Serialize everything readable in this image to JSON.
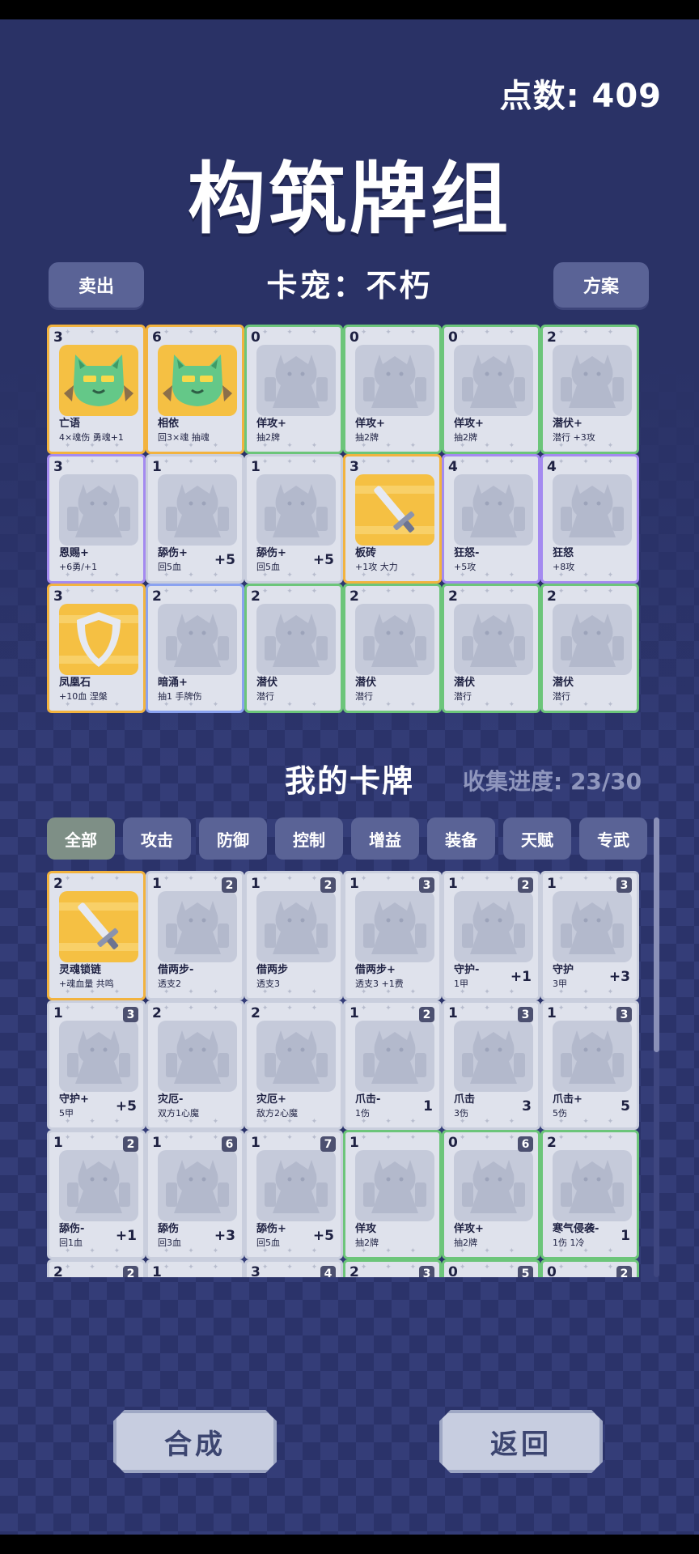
{
  "header": {
    "points_label": "点数: 409",
    "title": "构筑牌组",
    "pet_label": "卡宠：不朽",
    "sell_button": "卖出",
    "plan_button": "方案"
  },
  "deck": [
    {
      "cost": "3",
      "name": "亡语",
      "desc": "4×魂伤 勇魂+1",
      "value": "",
      "border": "orange",
      "art": "cat"
    },
    {
      "cost": "6",
      "name": "相依",
      "desc": "回3×魂 抽魂",
      "value": "",
      "border": "orange",
      "art": "cat"
    },
    {
      "cost": "0",
      "name": "佯攻+",
      "desc": "抽2牌",
      "value": "",
      "border": "green",
      "art": "ghost"
    },
    {
      "cost": "0",
      "name": "佯攻+",
      "desc": "抽2牌",
      "value": "",
      "border": "green",
      "art": "ghost"
    },
    {
      "cost": "0",
      "name": "佯攻+",
      "desc": "抽2牌",
      "value": "",
      "border": "green",
      "art": "ghost"
    },
    {
      "cost": "2",
      "name": "潜伏+",
      "desc": "潜行 +3攻",
      "value": "",
      "border": "green",
      "art": "ghost"
    },
    {
      "cost": "3",
      "name": "恩赐+",
      "desc": "+6勇/+1",
      "value": "",
      "border": "purple",
      "art": "ghost"
    },
    {
      "cost": "1",
      "name": "舔伤+",
      "desc": "回5血",
      "value": "+5",
      "border": "plain",
      "art": "ghost"
    },
    {
      "cost": "1",
      "name": "舔伤+",
      "desc": "回5血",
      "value": "+5",
      "border": "plain",
      "art": "ghost"
    },
    {
      "cost": "3",
      "name": "板砖",
      "desc": "+1攻 大力",
      "value": "",
      "border": "orange",
      "art": "sword"
    },
    {
      "cost": "4",
      "name": "狂怒-",
      "desc": "+5攻",
      "value": "",
      "border": "purple",
      "art": "ghost"
    },
    {
      "cost": "4",
      "name": "狂怒",
      "desc": "+8攻",
      "value": "",
      "border": "purple",
      "art": "ghost"
    },
    {
      "cost": "3",
      "name": "凤凰石",
      "desc": "+10血 涅槃",
      "value": "",
      "border": "orange",
      "art": "shield"
    },
    {
      "cost": "2",
      "name": "暗涌+",
      "desc": "抽1 手牌伤",
      "value": "",
      "border": "blue",
      "art": "ghost"
    },
    {
      "cost": "2",
      "name": "潜伏",
      "desc": "潜行",
      "value": "",
      "border": "green",
      "art": "ghost"
    },
    {
      "cost": "2",
      "name": "潜伏",
      "desc": "潜行",
      "value": "",
      "border": "green",
      "art": "ghost"
    },
    {
      "cost": "2",
      "name": "潜伏",
      "desc": "潜行",
      "value": "",
      "border": "green",
      "art": "ghost"
    },
    {
      "cost": "2",
      "name": "潜伏",
      "desc": "潜行",
      "value": "",
      "border": "green",
      "art": "ghost"
    }
  ],
  "collection": {
    "title": "我的卡牌",
    "progress": "收集进度: 23/30",
    "tabs": [
      "全部",
      "攻击",
      "防御",
      "控制",
      "增益",
      "装备",
      "天赋",
      "专武"
    ],
    "cards": [
      {
        "cost": "2",
        "count": "",
        "name": "灵魂锁链",
        "desc": "+魂血量 共鸣",
        "value": "",
        "border": "orange",
        "art": "sword"
      },
      {
        "cost": "1",
        "count": "2",
        "name": "借两步-",
        "desc": "透支2",
        "value": "",
        "border": "plain",
        "art": "ghost"
      },
      {
        "cost": "1",
        "count": "2",
        "name": "借两步",
        "desc": "透支3",
        "value": "",
        "border": "plain",
        "art": "ghost"
      },
      {
        "cost": "1",
        "count": "3",
        "name": "借两步+",
        "desc": "透支3 +1费",
        "value": "",
        "border": "plain",
        "art": "ghost"
      },
      {
        "cost": "1",
        "count": "2",
        "name": "守护-",
        "desc": "1甲",
        "value": "+1",
        "border": "plain",
        "art": "ghost"
      },
      {
        "cost": "1",
        "count": "3",
        "name": "守护",
        "desc": "3甲",
        "value": "+3",
        "border": "plain",
        "art": "ghost"
      },
      {
        "cost": "1",
        "count": "3",
        "name": "守护+",
        "desc": "5甲",
        "value": "+5",
        "border": "plain",
        "art": "ghost"
      },
      {
        "cost": "2",
        "count": "",
        "name": "灾厄-",
        "desc": "双方1心魔",
        "value": "",
        "border": "plain",
        "art": "ghost"
      },
      {
        "cost": "2",
        "count": "",
        "name": "灾厄+",
        "desc": "敌方2心魔",
        "value": "",
        "border": "plain",
        "art": "ghost"
      },
      {
        "cost": "1",
        "count": "2",
        "name": "爪击-",
        "desc": "1伤",
        "value": "1",
        "border": "plain",
        "art": "ghost"
      },
      {
        "cost": "1",
        "count": "3",
        "name": "爪击",
        "desc": "3伤",
        "value": "3",
        "border": "plain",
        "art": "ghost"
      },
      {
        "cost": "1",
        "count": "3",
        "name": "爪击+",
        "desc": "5伤",
        "value": "5",
        "border": "plain",
        "art": "ghost"
      },
      {
        "cost": "1",
        "count": "2",
        "name": "舔伤-",
        "desc": "回1血",
        "value": "+1",
        "border": "plain",
        "art": "ghost"
      },
      {
        "cost": "1",
        "count": "6",
        "name": "舔伤",
        "desc": "回3血",
        "value": "+3",
        "border": "plain",
        "art": "ghost"
      },
      {
        "cost": "1",
        "count": "7",
        "name": "舔伤+",
        "desc": "回5血",
        "value": "+5",
        "border": "plain",
        "art": "ghost"
      },
      {
        "cost": "1",
        "count": "",
        "name": "佯攻",
        "desc": "抽2牌",
        "value": "",
        "border": "green",
        "art": "ghost"
      },
      {
        "cost": "0",
        "count": "6",
        "name": "佯攻+",
        "desc": "抽2牌",
        "value": "",
        "border": "green",
        "art": "ghost"
      },
      {
        "cost": "2",
        "count": "",
        "name": "寒气侵袭-",
        "desc": "1伤 1冷",
        "value": "1",
        "border": "green",
        "art": "ghost"
      },
      {
        "cost": "2",
        "count": "2",
        "name": "",
        "desc": "",
        "value": "",
        "border": "plain",
        "art": "ghost"
      },
      {
        "cost": "1",
        "count": "",
        "name": "",
        "desc": "",
        "value": "",
        "border": "plain",
        "art": "ghost"
      },
      {
        "cost": "3",
        "count": "4",
        "name": "",
        "desc": "",
        "value": "",
        "border": "plain",
        "art": "ghost"
      },
      {
        "cost": "2",
        "count": "3",
        "name": "",
        "desc": "",
        "value": "",
        "border": "green",
        "art": "ghost"
      },
      {
        "cost": "0",
        "count": "5",
        "name": "",
        "desc": "",
        "value": "",
        "border": "green",
        "art": "ghost"
      },
      {
        "cost": "0",
        "count": "2",
        "name": "",
        "desc": "",
        "value": "",
        "border": "green",
        "art": "ghost"
      }
    ]
  },
  "footer": {
    "synthesize_button": "合成",
    "back_button": "返回"
  },
  "colors": {
    "background": "#2a3266",
    "button": "#5a6396",
    "active_tab": "#7e8f86",
    "border_orange": "#f2b33f",
    "border_green": "#6cc57a",
    "border_purple": "#a48af0",
    "card_face": "#dfe2ec"
  }
}
